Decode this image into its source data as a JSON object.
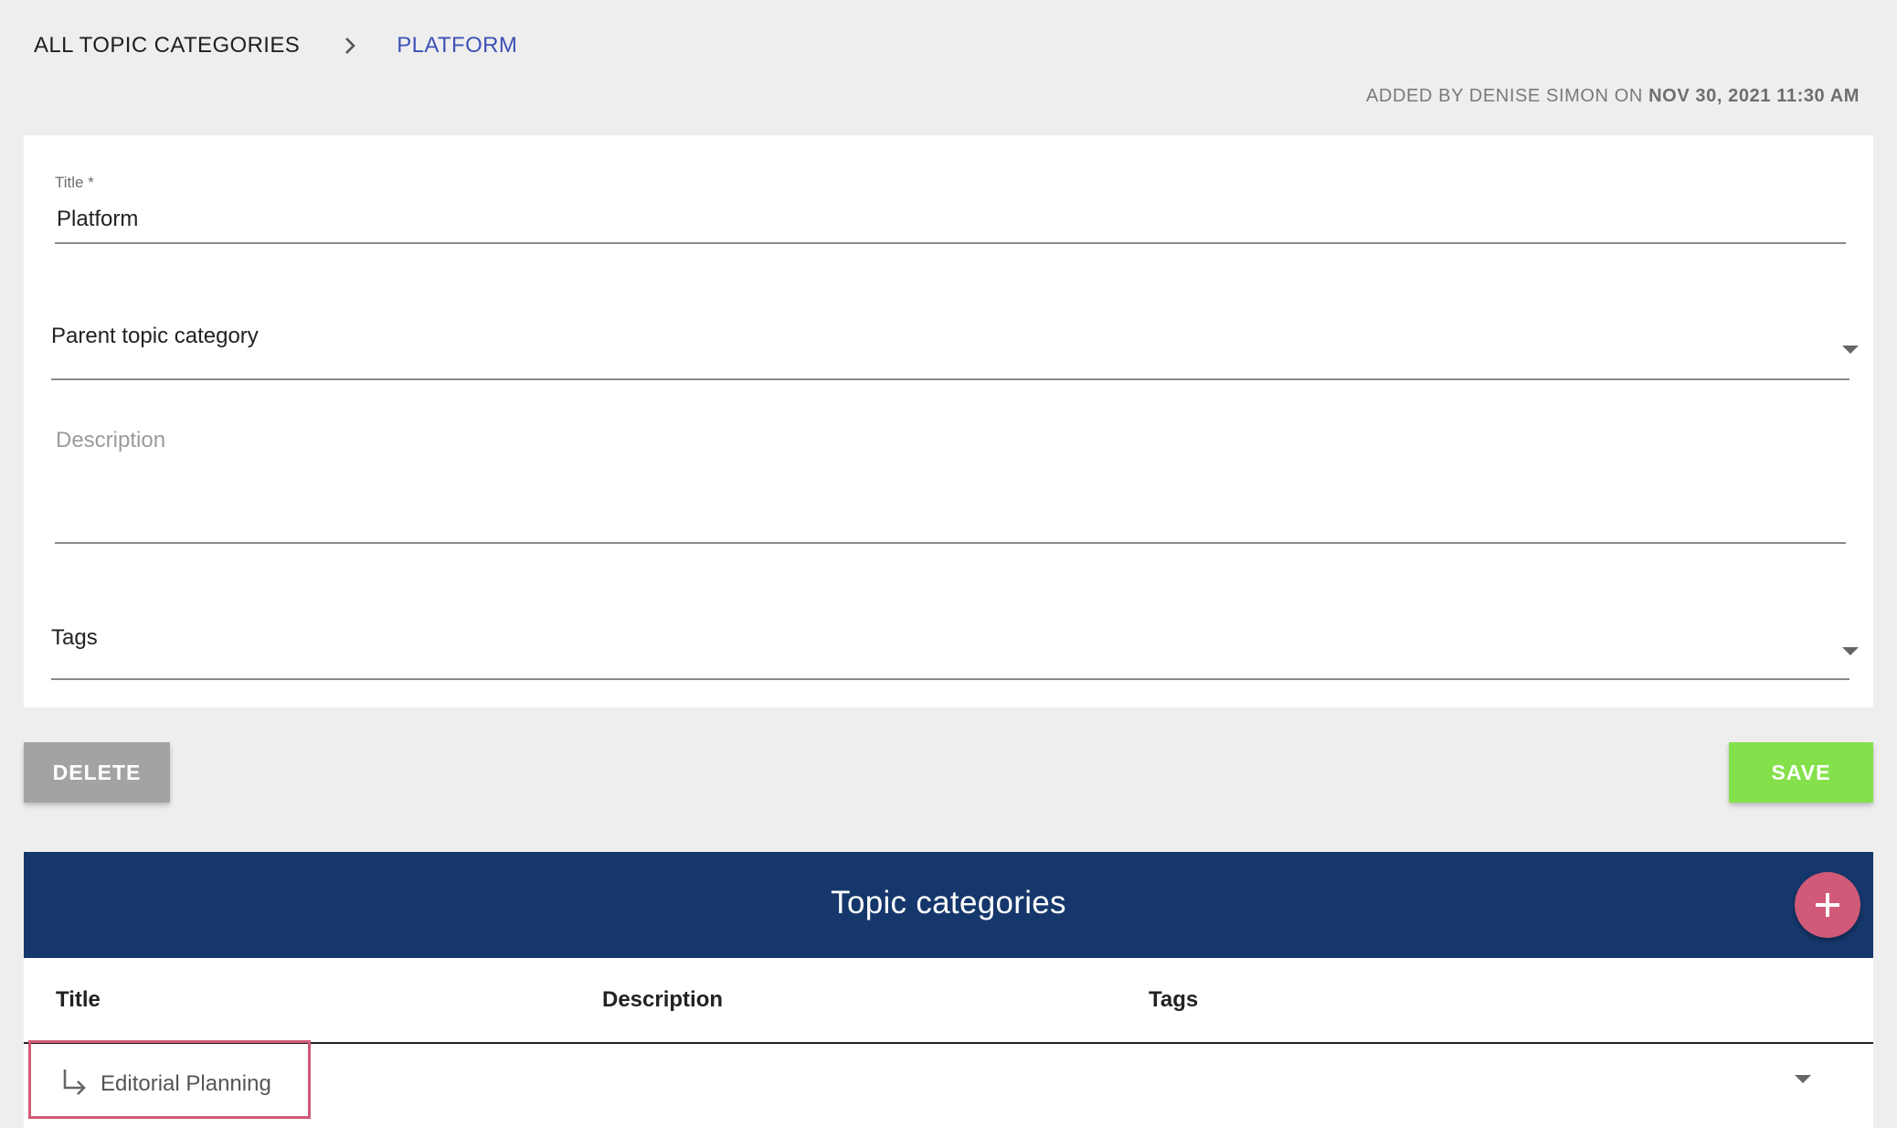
{
  "breadcrumb": {
    "root": "ALL TOPIC CATEGORIES",
    "current": "PLATFORM"
  },
  "meta": {
    "added_by": "ADDED BY DENISE SIMON ON",
    "date": "NOV 30, 2021 11:30 AM"
  },
  "form": {
    "title_label": "Title *",
    "title_value": "Platform",
    "parent_label": "Parent topic category",
    "description_placeholder": "Description",
    "tags_label": "Tags"
  },
  "actions": {
    "delete_label": "DELETE",
    "save_label": "SAVE"
  },
  "table": {
    "title": "Topic categories",
    "columns": [
      "Title",
      "Description",
      "Tags"
    ],
    "rows": [
      {
        "title": "Editorial Planning",
        "description": "",
        "tags": ""
      }
    ]
  },
  "colors": {
    "accent": "#3f51b5",
    "header_bar": "#15376b",
    "save": "#84e14c",
    "delete": "#a3a3a3",
    "fab": "#d05a78"
  },
  "icons": [
    "chevron-right-icon",
    "dropdown-arrow-icon",
    "plus-icon",
    "subdirectory-arrow-icon"
  ]
}
